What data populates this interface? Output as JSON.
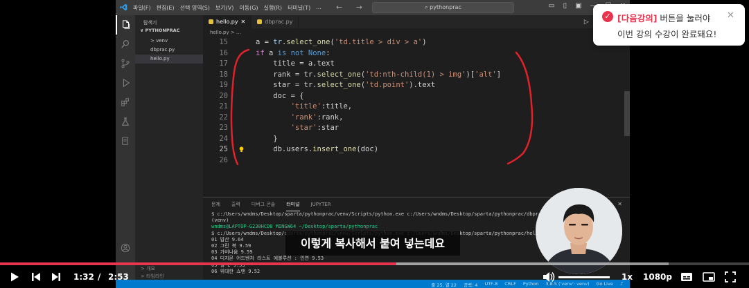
{
  "vscode": {
    "menus": [
      "파일(F)",
      "편집(E)",
      "선택 영역(S)",
      "보기(V)",
      "이동(G)",
      "실행(R)",
      "터미널(T)",
      "..."
    ],
    "nav_arrows": "← →",
    "command_center": "⌕ pythonprac",
    "window_controls": [
      "▭",
      "▯",
      "▣",
      "—",
      "☐",
      "✕"
    ],
    "sidebar": {
      "header": "탐색기",
      "folder": "∨ PYTHONPRAC",
      "items": [
        "> venv",
        "dbprac.py",
        "hello.py"
      ],
      "selected_index": 2,
      "outline": [
        "> 개요",
        "> 타임라인"
      ]
    },
    "tabs": [
      {
        "label": "hello.py",
        "active": true,
        "close": "✕"
      },
      {
        "label": "dbprac.py",
        "active": false,
        "close": ""
      }
    ],
    "editor_actions": "▷ ◫ …",
    "breadcrumb": "hello.py > ...",
    "code_lines": [
      {
        "num": "15",
        "html": "a = <span class=\"v\">tr</span>.<span class=\"f\">select_one</span>(<span class=\"s\">'td.title > div > a'</span>)"
      },
      {
        "num": "16",
        "html": "<span class=\"c\">if</span> a <span class=\"k\">is not</span> <span class=\"k\">None</span>:"
      },
      {
        "num": "17",
        "html": "    title = a.text"
      },
      {
        "num": "18",
        "html": "    rank = tr.<span class=\"f\">select_one</span>(<span class=\"s\">'td:nth-child(1) > img'</span>)[<span class=\"s\">'alt'</span>]"
      },
      {
        "num": "19",
        "html": "    star = tr.<span class=\"f\">select_one</span>(<span class=\"s\">'td.point'</span>).text"
      },
      {
        "num": "20",
        "html": "    doc = {"
      },
      {
        "num": "21",
        "html": "        <span class=\"s\">'title'</span>:title,"
      },
      {
        "num": "22",
        "html": "        <span class=\"s\">'rank'</span>:rank,"
      },
      {
        "num": "23",
        "html": "        <span class=\"s\">'star'</span>:star"
      },
      {
        "num": "24",
        "html": "    }"
      },
      {
        "num": "25",
        "html": "    db.users.<span class=\"f\">insert_one</span>(doc)"
      },
      {
        "num": "26",
        "html": ""
      }
    ],
    "current_line": "25",
    "panel_tabs": [
      "문제",
      "출력",
      "디버그 콘솔",
      "터미널",
      "JUPYTER"
    ],
    "active_panel_tab": "터미널",
    "panel_actions": "⊞ ▾ ⊡ 🗑 ∧ ✕",
    "terminal_lines": [
      {
        "text": "$ c:/Users/wndms/Desktop/sparta/pythonprac/venv/Scripts/python.exe c:/Users/wndms/Desktop/sparta/pythonprac/dbprac.py",
        "cls": ""
      },
      {
        "text": "(venv)",
        "cls": ""
      },
      {
        "text": "wndms@LAPTOP-G230HCD8 MINGW64 ~/Desktop/sparta/pythonprac",
        "cls": "green"
      },
      {
        "text": "$ c:/Users/wndms/Desktop/sparta/pythonprac/venv/Scripts/python.exe c:/Users/wndms/Desktop/sparta/pythonprac/hello.py",
        "cls": ""
      },
      {
        "text": "01 밥산 9.64",
        "cls": ""
      },
      {
        "text": "02 그린 북 9.59",
        "cls": ""
      },
      {
        "text": "03 가버나움 9.59",
        "cls": ""
      },
      {
        "text": "04 디지몬 어드벤처 라스트 에볼루션 : 인연 9.53",
        "cls": ""
      },
      {
        "text": "05 월-E 9.53",
        "cls": ""
      },
      {
        "text": "06 위대한 쇼맨 9.52",
        "cls": ""
      }
    ],
    "status": [
      "줄 25, 열 22",
      "공백: 4",
      "UTF-8",
      "CRLF",
      "Python",
      "3.8.5 ('venv': venv)",
      "Go Live",
      "♪"
    ]
  },
  "subtitle": "이렇게 복사해서 붙여 넣는데요",
  "toast": {
    "accent_text": "[다음강의]",
    "line1_rest": " 버튼을 눌러야",
    "line2": "이번 강의 수강이 완료돼요!",
    "close": "✕",
    "accent_color": "#e8344e"
  },
  "player": {
    "current_time": "1:32",
    "separator": "/",
    "duration": "2:53",
    "played_fraction": 0.529,
    "loaded_fraction": 0.893,
    "speed": "1x",
    "quality": "1080p",
    "accent_color": "#e8344e"
  }
}
